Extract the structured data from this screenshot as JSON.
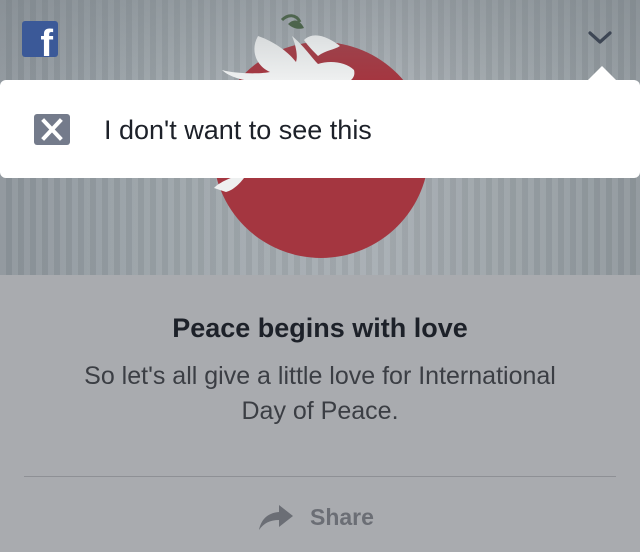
{
  "post": {
    "source_icon": "facebook-logo-icon",
    "source_icon_glyph": "f",
    "menu_icon": "chevron-down-icon"
  },
  "hide_menu": {
    "icon": "close-box-icon",
    "label": "I don't want to see this"
  },
  "link_preview": {
    "title": "Peace begins with love",
    "description": "So let's all give a little love for International Day of Peace."
  },
  "actions": {
    "share_icon": "share-arrow-icon",
    "share_label": "Share"
  },
  "colors": {
    "facebook_blue": "#3b5998",
    "dim_overlay": "#a9abaf",
    "popup_bg": "#ffffff",
    "close_icon_bg": "#747b8b",
    "circle_red": "#a43640"
  }
}
